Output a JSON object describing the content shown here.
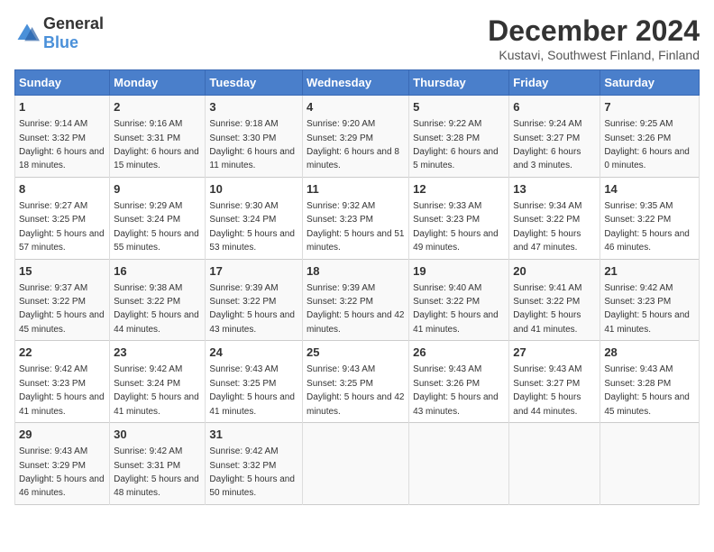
{
  "logo": {
    "general": "General",
    "blue": "Blue"
  },
  "title": "December 2024",
  "subtitle": "Kustavi, Southwest Finland, Finland",
  "days_of_week": [
    "Sunday",
    "Monday",
    "Tuesday",
    "Wednesday",
    "Thursday",
    "Friday",
    "Saturday"
  ],
  "weeks": [
    [
      {
        "day": "1",
        "sunrise": "9:14 AM",
        "sunset": "3:32 PM",
        "daylight": "6 hours and 18 minutes."
      },
      {
        "day": "2",
        "sunrise": "9:16 AM",
        "sunset": "3:31 PM",
        "daylight": "6 hours and 15 minutes."
      },
      {
        "day": "3",
        "sunrise": "9:18 AM",
        "sunset": "3:30 PM",
        "daylight": "6 hours and 11 minutes."
      },
      {
        "day": "4",
        "sunrise": "9:20 AM",
        "sunset": "3:29 PM",
        "daylight": "6 hours and 8 minutes."
      },
      {
        "day": "5",
        "sunrise": "9:22 AM",
        "sunset": "3:28 PM",
        "daylight": "6 hours and 5 minutes."
      },
      {
        "day": "6",
        "sunrise": "9:24 AM",
        "sunset": "3:27 PM",
        "daylight": "6 hours and 3 minutes."
      },
      {
        "day": "7",
        "sunrise": "9:25 AM",
        "sunset": "3:26 PM",
        "daylight": "6 hours and 0 minutes."
      }
    ],
    [
      {
        "day": "8",
        "sunrise": "9:27 AM",
        "sunset": "3:25 PM",
        "daylight": "5 hours and 57 minutes."
      },
      {
        "day": "9",
        "sunrise": "9:29 AM",
        "sunset": "3:24 PM",
        "daylight": "5 hours and 55 minutes."
      },
      {
        "day": "10",
        "sunrise": "9:30 AM",
        "sunset": "3:24 PM",
        "daylight": "5 hours and 53 minutes."
      },
      {
        "day": "11",
        "sunrise": "9:32 AM",
        "sunset": "3:23 PM",
        "daylight": "5 hours and 51 minutes."
      },
      {
        "day": "12",
        "sunrise": "9:33 AM",
        "sunset": "3:23 PM",
        "daylight": "5 hours and 49 minutes."
      },
      {
        "day": "13",
        "sunrise": "9:34 AM",
        "sunset": "3:22 PM",
        "daylight": "5 hours and 47 minutes."
      },
      {
        "day": "14",
        "sunrise": "9:35 AM",
        "sunset": "3:22 PM",
        "daylight": "5 hours and 46 minutes."
      }
    ],
    [
      {
        "day": "15",
        "sunrise": "9:37 AM",
        "sunset": "3:22 PM",
        "daylight": "5 hours and 45 minutes."
      },
      {
        "day": "16",
        "sunrise": "9:38 AM",
        "sunset": "3:22 PM",
        "daylight": "5 hours and 44 minutes."
      },
      {
        "day": "17",
        "sunrise": "9:39 AM",
        "sunset": "3:22 PM",
        "daylight": "5 hours and 43 minutes."
      },
      {
        "day": "18",
        "sunrise": "9:39 AM",
        "sunset": "3:22 PM",
        "daylight": "5 hours and 42 minutes."
      },
      {
        "day": "19",
        "sunrise": "9:40 AM",
        "sunset": "3:22 PM",
        "daylight": "5 hours and 41 minutes."
      },
      {
        "day": "20",
        "sunrise": "9:41 AM",
        "sunset": "3:22 PM",
        "daylight": "5 hours and 41 minutes."
      },
      {
        "day": "21",
        "sunrise": "9:42 AM",
        "sunset": "3:23 PM",
        "daylight": "5 hours and 41 minutes."
      }
    ],
    [
      {
        "day": "22",
        "sunrise": "9:42 AM",
        "sunset": "3:23 PM",
        "daylight": "5 hours and 41 minutes."
      },
      {
        "day": "23",
        "sunrise": "9:42 AM",
        "sunset": "3:24 PM",
        "daylight": "5 hours and 41 minutes."
      },
      {
        "day": "24",
        "sunrise": "9:43 AM",
        "sunset": "3:25 PM",
        "daylight": "5 hours and 41 minutes."
      },
      {
        "day": "25",
        "sunrise": "9:43 AM",
        "sunset": "3:25 PM",
        "daylight": "5 hours and 42 minutes."
      },
      {
        "day": "26",
        "sunrise": "9:43 AM",
        "sunset": "3:26 PM",
        "daylight": "5 hours and 43 minutes."
      },
      {
        "day": "27",
        "sunrise": "9:43 AM",
        "sunset": "3:27 PM",
        "daylight": "5 hours and 44 minutes."
      },
      {
        "day": "28",
        "sunrise": "9:43 AM",
        "sunset": "3:28 PM",
        "daylight": "5 hours and 45 minutes."
      }
    ],
    [
      {
        "day": "29",
        "sunrise": "9:43 AM",
        "sunset": "3:29 PM",
        "daylight": "5 hours and 46 minutes."
      },
      {
        "day": "30",
        "sunrise": "9:42 AM",
        "sunset": "3:31 PM",
        "daylight": "5 hours and 48 minutes."
      },
      {
        "day": "31",
        "sunrise": "9:42 AM",
        "sunset": "3:32 PM",
        "daylight": "5 hours and 50 minutes."
      },
      null,
      null,
      null,
      null
    ]
  ]
}
